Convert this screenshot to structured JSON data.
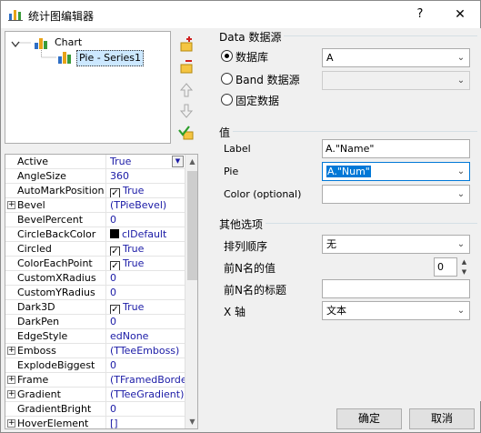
{
  "window": {
    "title": "统计图编辑器",
    "help_label": "?",
    "close_label": "✕"
  },
  "tree": {
    "root_label": "Chart",
    "child_label": "Pie - Series1"
  },
  "tools": [
    "add-series-icon",
    "delete-series-icon",
    "move-up-icon",
    "move-down-icon",
    "check-icon"
  ],
  "properties": [
    {
      "name": "Active",
      "value": "True",
      "dropdown": true
    },
    {
      "name": "AngleSize",
      "value": "360"
    },
    {
      "name": "AutoMarkPosition",
      "value": "True",
      "checkbox": true
    },
    {
      "name": "Bevel",
      "value": "(TPieBevel)",
      "expandable": true
    },
    {
      "name": "BevelPercent",
      "value": "0"
    },
    {
      "name": "CircleBackColor",
      "value": "clDefault",
      "swatch": "#000000"
    },
    {
      "name": "Circled",
      "value": "True",
      "checkbox": true
    },
    {
      "name": "ColorEachPoint",
      "value": "True",
      "checkbox": true
    },
    {
      "name": "CustomXRadius",
      "value": "0"
    },
    {
      "name": "CustomYRadius",
      "value": "0"
    },
    {
      "name": "Dark3D",
      "value": "True",
      "checkbox": true
    },
    {
      "name": "DarkPen",
      "value": "0"
    },
    {
      "name": "EdgeStyle",
      "value": "edNone"
    },
    {
      "name": "Emboss",
      "value": "(TTeeEmboss)",
      "expandable": true
    },
    {
      "name": "ExplodeBiggest",
      "value": "0"
    },
    {
      "name": "Frame",
      "value": "(TFramedBorder)",
      "expandable": true
    },
    {
      "name": "Gradient",
      "value": "(TTeeGradient)",
      "expandable": true
    },
    {
      "name": "GradientBright",
      "value": "0"
    },
    {
      "name": "HoverElement",
      "value": "[]",
      "expandable": true
    }
  ],
  "datasource": {
    "group_title": "Data 数据源",
    "options": [
      {
        "label": "数据库",
        "checked": true,
        "combo_value": "A",
        "combo_enabled": true
      },
      {
        "label": "Band 数据源",
        "checked": false,
        "combo_value": "",
        "combo_enabled": false
      },
      {
        "label": "固定数据",
        "checked": false
      }
    ]
  },
  "values": {
    "group_title": "值",
    "label_caption": "Label",
    "label_value": "A.\"Name\"",
    "pie_caption": "Pie",
    "pie_value": "A.\"Num\"",
    "color_caption": "Color (optional)",
    "color_value": ""
  },
  "other": {
    "group_title": "其他选项",
    "sort_caption": "排列顺序",
    "sort_value": "无",
    "topn_caption": "前N名的值",
    "topn_value": "0",
    "topn_title_caption": "前N名的标题",
    "topn_title_value": "",
    "xaxis_caption": "X 轴",
    "xaxis_value": "文本"
  },
  "buttons": {
    "ok": "确定",
    "cancel": "取消"
  },
  "colors": {
    "accent": "#0078d7",
    "selection_bg": "#cce8ff",
    "property_value": "#1a1aa6"
  }
}
